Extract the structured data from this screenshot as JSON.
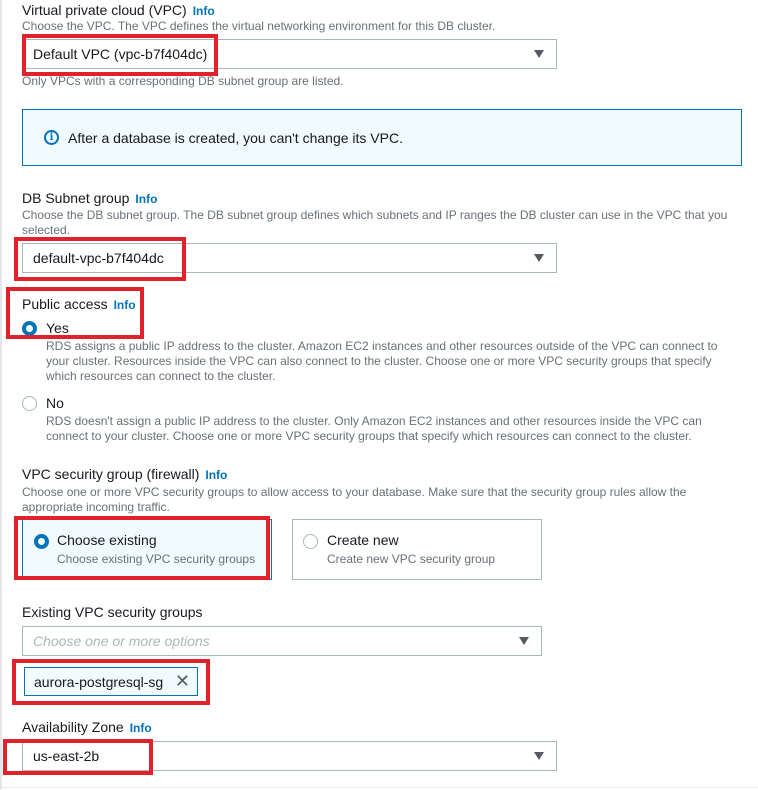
{
  "vpc": {
    "label": "Virtual private cloud (VPC)",
    "info": "Info",
    "description": "Choose the VPC. The VPC defines the virtual networking environment for this DB cluster.",
    "selected": "Default VPC (vpc-b7f404dc)",
    "hint": "Only VPCs with a corresponding DB subnet group are listed."
  },
  "alert": {
    "icon": "info-circle-icon",
    "text": "After a database is created, you can't change its VPC."
  },
  "subnet": {
    "label": "DB Subnet group",
    "info": "Info",
    "description_line1": "Choose the DB subnet group. The DB subnet group defines which subnets and IP ranges the DB cluster can use in the VPC that you",
    "description_line2": "selected.",
    "selected": "default-vpc-b7f404dc"
  },
  "public_access": {
    "label": "Public access",
    "info": "Info",
    "selected": "Yes",
    "options": [
      {
        "label": "Yes",
        "lines": [
          "RDS assigns a public IP address to the cluster. Amazon EC2 instances and other resources outside of the VPC can connect to",
          "your cluster. Resources inside the VPC can also connect to the cluster. Choose one or more VPC security groups that specify",
          "which resources can connect to the cluster."
        ]
      },
      {
        "label": "No",
        "lines": [
          "RDS doesn't assign a public IP address to the cluster. Only Amazon EC2 instances and other resources inside the VPC can",
          "connect to your cluster. Choose one or more VPC security groups that specify which resources can connect to the cluster."
        ]
      }
    ]
  },
  "security_group": {
    "label": "VPC security group (firewall)",
    "info": "Info",
    "description_line1": "Choose one or more VPC security groups to allow access to your database. Make sure that the security group rules allow the",
    "description_line2": "appropriate incoming traffic.",
    "selected": "Choose existing",
    "tiles": [
      {
        "title": "Choose existing",
        "desc": "Choose existing VPC security groups"
      },
      {
        "title": "Create new",
        "desc": "Create new VPC security group"
      }
    ]
  },
  "existing_groups": {
    "label": "Existing VPC security groups",
    "placeholder": "Choose one or more options",
    "tokens": [
      "aurora-postgresql-sg"
    ]
  },
  "availability_zone": {
    "label": "Availability Zone",
    "info": "Info",
    "selected": "us-east-2b"
  },
  "colors": {
    "accent": "#0073bb",
    "highlight": "#e1222c",
    "selected_bg": "#f1faff",
    "text": "#16191f",
    "secondary_text": "#687078"
  }
}
